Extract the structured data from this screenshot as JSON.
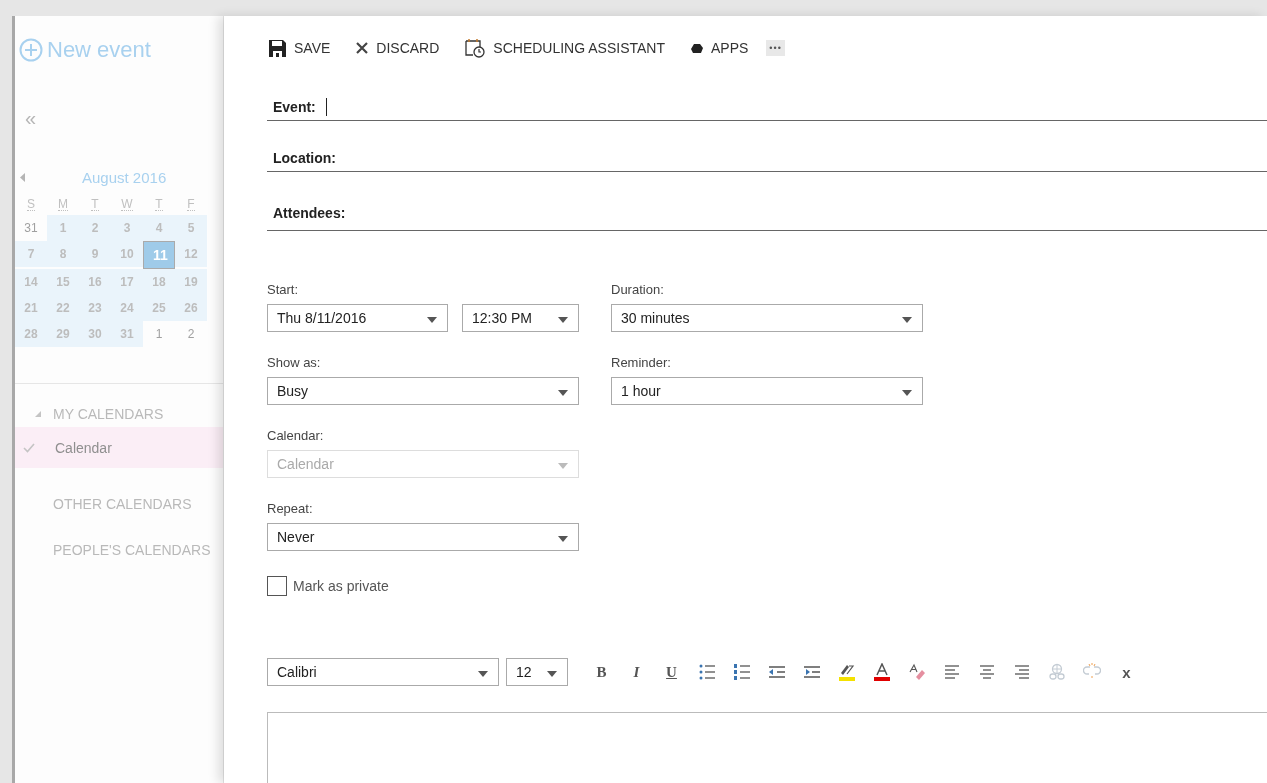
{
  "sidebar": {
    "new_event": "New event",
    "collapse": "«",
    "calendar": {
      "month": "August 2016",
      "weekdays": [
        "S",
        "M",
        "T",
        "W",
        "T",
        "F"
      ],
      "weeks": [
        [
          {
            "day": "31",
            "in_month": false,
            "selected": false
          },
          {
            "day": "1",
            "in_month": true,
            "selected": false
          },
          {
            "day": "2",
            "in_month": true,
            "selected": false
          },
          {
            "day": "3",
            "in_month": true,
            "selected": false
          },
          {
            "day": "4",
            "in_month": true,
            "selected": false
          },
          {
            "day": "5",
            "in_month": true,
            "selected": false
          }
        ],
        [
          {
            "day": "7",
            "in_month": true,
            "selected": false
          },
          {
            "day": "8",
            "in_month": true,
            "selected": false
          },
          {
            "day": "9",
            "in_month": true,
            "selected": false
          },
          {
            "day": "10",
            "in_month": true,
            "selected": false
          },
          {
            "day": "11",
            "in_month": true,
            "selected": true
          },
          {
            "day": "12",
            "in_month": true,
            "selected": false
          }
        ],
        [
          {
            "day": "14",
            "in_month": true,
            "selected": false
          },
          {
            "day": "15",
            "in_month": true,
            "selected": false
          },
          {
            "day": "16",
            "in_month": true,
            "selected": false
          },
          {
            "day": "17",
            "in_month": true,
            "selected": false
          },
          {
            "day": "18",
            "in_month": true,
            "selected": false
          },
          {
            "day": "19",
            "in_month": true,
            "selected": false
          }
        ],
        [
          {
            "day": "21",
            "in_month": true,
            "selected": false
          },
          {
            "day": "22",
            "in_month": true,
            "selected": false
          },
          {
            "day": "23",
            "in_month": true,
            "selected": false
          },
          {
            "day": "24",
            "in_month": true,
            "selected": false
          },
          {
            "day": "25",
            "in_month": true,
            "selected": false
          },
          {
            "day": "26",
            "in_month": true,
            "selected": false
          }
        ],
        [
          {
            "day": "28",
            "in_month": true,
            "selected": false
          },
          {
            "day": "29",
            "in_month": true,
            "selected": false
          },
          {
            "day": "30",
            "in_month": true,
            "selected": false
          },
          {
            "day": "31",
            "in_month": true,
            "selected": false
          },
          {
            "day": "1",
            "in_month": false,
            "selected": false
          },
          {
            "day": "2",
            "in_month": false,
            "selected": false
          }
        ]
      ]
    },
    "items": [
      {
        "kind": "group",
        "label": "MY CALENDARS",
        "expanded": true
      },
      {
        "kind": "calendar",
        "label": "Calendar",
        "checked": true,
        "selected": true
      },
      {
        "kind": "group",
        "label": "OTHER CALENDARS"
      },
      {
        "kind": "group",
        "label": "PEOPLE'S CALENDARS"
      }
    ]
  },
  "toolbar": [
    {
      "kind": "save",
      "label": "SAVE"
    },
    {
      "kind": "discard",
      "label": "DISCARD"
    },
    {
      "kind": "scheduling",
      "label": "SCHEDULING ASSISTANT"
    },
    {
      "kind": "apps",
      "label": "APPS"
    },
    {
      "kind": "more",
      "label": "•••"
    }
  ],
  "fields": [
    {
      "label": "Event:",
      "focused": true
    },
    {
      "label": "Location:",
      "focused": false
    },
    {
      "label": "Attendees:",
      "focused": false
    }
  ],
  "form": {
    "start": {
      "label": "Start:",
      "date": "Thu 8/11/2016",
      "time": "12:30 PM"
    },
    "duration": {
      "label": "Duration:",
      "value": "30 minutes"
    },
    "show_as": {
      "label": "Show as:",
      "value": "Busy"
    },
    "reminder": {
      "label": "Reminder:",
      "value": "1 hour"
    },
    "calendar": {
      "label": "Calendar:",
      "value": "Calendar",
      "disabled": true
    },
    "repeat": {
      "label": "Repeat:",
      "value": "Never"
    },
    "private": {
      "label": "Mark as private",
      "checked": false
    }
  },
  "editor": {
    "font": "Calibri",
    "size": "12",
    "tools": [
      {
        "kind": "bold",
        "label": "B"
      },
      {
        "kind": "italic",
        "label": "I"
      },
      {
        "kind": "underline",
        "label": "U"
      },
      {
        "kind": "bullets"
      },
      {
        "kind": "numbering"
      },
      {
        "kind": "outdent"
      },
      {
        "kind": "indent"
      },
      {
        "kind": "highlight"
      },
      {
        "kind": "font_color"
      },
      {
        "kind": "clear_format"
      },
      {
        "kind": "align_left"
      },
      {
        "kind": "align_center"
      },
      {
        "kind": "align_right"
      },
      {
        "kind": "link",
        "disabled": true
      },
      {
        "kind": "unlink",
        "disabled": true
      },
      {
        "kind": "text",
        "label": "x"
      }
    ]
  }
}
